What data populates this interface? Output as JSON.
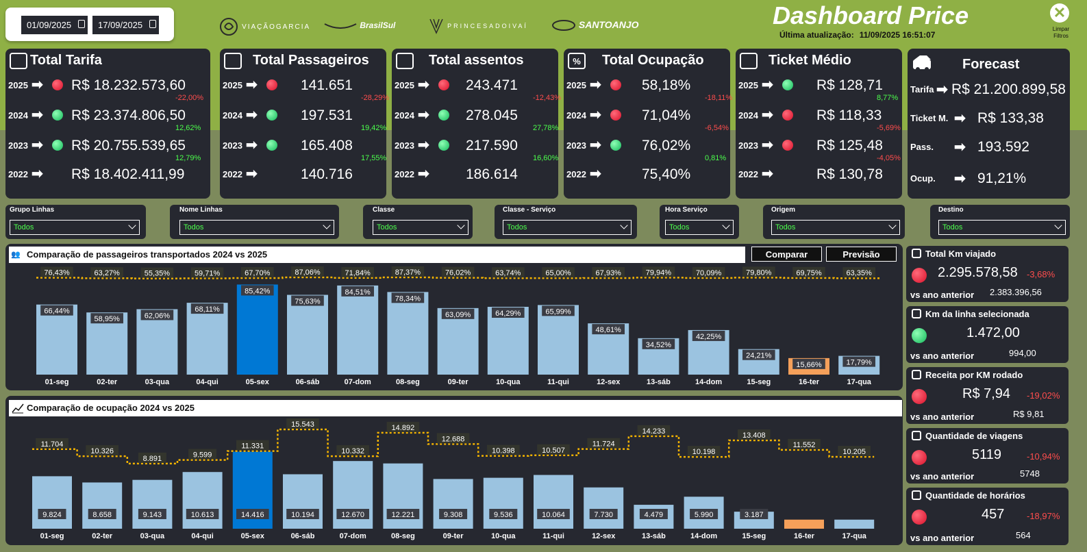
{
  "header": {
    "date_from": "01/09/2025",
    "date_to": "17/09/2025",
    "logos": [
      "VIAÇÃOGARCIA",
      "BrasilSul",
      "PRINCESADOIVAÍ",
      "SANTOANJO"
    ],
    "title": "Dashboard Price",
    "update_label": "Última atualização:",
    "update_value": "11/09/2025 16:51:07",
    "clear_label": "Limpar Filtros"
  },
  "cards": [
    {
      "title": "Total Tarifa",
      "icon": "cash-icon",
      "rows": [
        {
          "year": "2025",
          "dot": "red",
          "value": "R$ 18.232.573,60",
          "pct": "-22,00%",
          "pct_type": "neg"
        },
        {
          "year": "2024",
          "dot": "green",
          "value": "R$ 23.374.806,50",
          "pct": "12,62%",
          "pct_type": "pos"
        },
        {
          "year": "2023",
          "dot": "green",
          "value": "R$ 20.755.539,65",
          "pct": "12,79%",
          "pct_type": "pos"
        },
        {
          "year": "2022",
          "dot": "",
          "value": "R$ 18.402.411,99",
          "pct": "",
          "pct_type": ""
        }
      ]
    },
    {
      "title": "Total Passageiros",
      "icon": "people-icon",
      "rows": [
        {
          "year": "2025",
          "dot": "red",
          "value": "141.651",
          "pct": "-28,29%",
          "pct_type": "neg"
        },
        {
          "year": "2024",
          "dot": "green",
          "value": "197.531",
          "pct": "19,42%",
          "pct_type": "pos"
        },
        {
          "year": "2023",
          "dot": "green",
          "value": "165.408",
          "pct": "17,55%",
          "pct_type": "pos"
        },
        {
          "year": "2022",
          "dot": "",
          "value": "140.716",
          "pct": "",
          "pct_type": ""
        }
      ]
    },
    {
      "title": "Total assentos",
      "icon": "seat-icon",
      "rows": [
        {
          "year": "2025",
          "dot": "red",
          "value": "243.471",
          "pct": "-12,43%",
          "pct_type": "neg"
        },
        {
          "year": "2024",
          "dot": "green",
          "value": "278.045",
          "pct": "27,78%",
          "pct_type": "pos"
        },
        {
          "year": "2023",
          "dot": "green",
          "value": "217.590",
          "pct": "16,60%",
          "pct_type": "pos"
        },
        {
          "year": "2022",
          "dot": "",
          "value": "186.614",
          "pct": "",
          "pct_type": ""
        }
      ]
    },
    {
      "title": "Total Ocupação",
      "icon": "percent-icon",
      "rows": [
        {
          "year": "2025",
          "dot": "red",
          "value": "58,18%",
          "pct": "-18,11%",
          "pct_type": "neg"
        },
        {
          "year": "2024",
          "dot": "red",
          "value": "71,04%",
          "pct": "-6,54%",
          "pct_type": "neg"
        },
        {
          "year": "2023",
          "dot": "green",
          "value": "76,02%",
          "pct": "0,81%",
          "pct_type": "pos"
        },
        {
          "year": "2022",
          "dot": "",
          "value": "75,40%",
          "pct": "",
          "pct_type": ""
        }
      ]
    },
    {
      "title": "Ticket Médio",
      "icon": "ticket-icon",
      "rows": [
        {
          "year": "2025",
          "dot": "green",
          "value": "R$ 128,71",
          "pct": "8,77%",
          "pct_type": "pos"
        },
        {
          "year": "2024",
          "dot": "red",
          "value": "R$ 118,33",
          "pct": "-5,69%",
          "pct_type": "neg"
        },
        {
          "year": "2023",
          "dot": "red",
          "value": "R$ 125,48",
          "pct": "-4,05%",
          "pct_type": "neg"
        },
        {
          "year": "2022",
          "dot": "",
          "value": "R$ 130,78",
          "pct": "",
          "pct_type": ""
        }
      ]
    }
  ],
  "forecast": {
    "title": "Forecast",
    "rows": [
      {
        "label": "Tarifa",
        "value": "R$ 21.200.899,58"
      },
      {
        "label": "Ticket M.",
        "value": "R$ 133,38"
      },
      {
        "label": "Pass.",
        "value": "193.592"
      },
      {
        "label": "Ocup.",
        "value": "91,21%"
      }
    ]
  },
  "filters": [
    {
      "label": "Grupo Linhas",
      "value": "Todos"
    },
    {
      "label": "Nome Linhas",
      "value": "Todos"
    },
    {
      "label": "Classe",
      "value": "Todos"
    },
    {
      "label": "Classe - Serviço",
      "value": "Todos"
    },
    {
      "label": "Hora Serviço",
      "value": "Todos"
    },
    {
      "label": "Origem",
      "value": "Todos"
    },
    {
      "label": "Destino",
      "value": "Todos"
    }
  ],
  "buttons": {
    "compare": "Comparar",
    "forecast": "Previsão"
  },
  "chart_data": [
    {
      "type": "bar",
      "title": "Comparação de passageiros transportados 2024 vs 2025",
      "categories": [
        "01-seg",
        "02-ter",
        "03-qua",
        "04-qui",
        "05-sex",
        "06-sáb",
        "07-dom",
        "08-seg",
        "09-ter",
        "10-qua",
        "11-qui",
        "12-sex",
        "13-sáb",
        "14-dom",
        "15-seg",
        "16-ter",
        "17-qua"
      ],
      "series": [
        {
          "values": [
            66.44,
            58.95,
            62.06,
            68.11,
            85.42,
            75.63,
            84.51,
            78.34,
            63.09,
            64.29,
            65.99,
            48.61,
            34.52,
            42.25,
            24.21,
            15.66,
            17.79
          ],
          "labels": [
            "66,44%",
            "58,95%",
            "62,06%",
            "68,11%",
            "85,42%",
            "75,63%",
            "84,51%",
            "78,34%",
            "63,09%",
            "64,29%",
            "65,99%",
            "48,61%",
            "34,52%",
            "42,25%",
            "24,21%",
            "15,66%",
            "17,79%"
          ]
        },
        {
          "type": "line",
          "values": [
            76.43,
            63.27,
            55.35,
            59.71,
            67.7,
            87.06,
            71.84,
            87.37,
            76.02,
            63.74,
            65.0,
            67.93,
            79.94,
            70.09,
            79.8,
            69.75,
            63.35
          ],
          "labels": [
            "76,43%",
            "63,27%",
            "55,35%",
            "59,71%",
            "67,70%",
            "87,06%",
            "71,84%",
            "87,37%",
            "76,02%",
            "63,74%",
            "65,00%",
            "67,93%",
            "79,94%",
            "70,09%",
            "79,80%",
            "69,75%",
            "63,35%"
          ]
        }
      ],
      "highlight": {
        "05-sex": "#0078d4",
        "16-ter": "#f5a05a"
      },
      "colors": {
        "bar": "#9bc3e0",
        "line": "#f5b400"
      }
    },
    {
      "type": "bar",
      "title": "Comparação de ocupação 2024 vs 2025",
      "categories": [
        "01-seg",
        "02-ter",
        "03-qua",
        "04-qui",
        "05-sex",
        "06-sáb",
        "07-dom",
        "08-seg",
        "09-ter",
        "10-qua",
        "11-qui",
        "12-sex",
        "13-sáb",
        "14-dom",
        "15-seg",
        "16-ter",
        "17-qua"
      ],
      "series": [
        {
          "values": [
            9824,
            8658,
            9143,
            10613,
            14416,
            10194,
            12670,
            12221,
            9308,
            9536,
            10064,
            7730,
            4479,
            5990,
            3187,
            1700,
            1700
          ],
          "labels": [
            "9.824",
            "8.658",
            "9.143",
            "10.613",
            "14.416",
            "10.194",
            "12.670",
            "12.221",
            "9.308",
            "9.536",
            "10.064",
            "7.730",
            "4.479",
            "5.990",
            "3.187",
            "",
            ""
          ]
        },
        {
          "type": "line",
          "values": [
            11704,
            10326,
            8891,
            9599,
            11331,
            15543,
            10332,
            14892,
            12688,
            10398,
            10507,
            11724,
            14233,
            10198,
            13408,
            11552,
            10205
          ],
          "labels": [
            "11.704",
            "10.326",
            "8.891",
            "9.599",
            "11.331",
            "15.543",
            "10.332",
            "14.892",
            "12.688",
            "10.398",
            "10.507",
            "11.724",
            "14.233",
            "10.198",
            "13.408",
            "11.552",
            "10.205"
          ]
        }
      ],
      "highlight": {
        "05-sex": "#0078d4",
        "16-ter": "#f5a05a"
      },
      "colors": {
        "bar": "#9bc3e0",
        "line": "#f5b400"
      }
    }
  ],
  "side": [
    {
      "title": "Total Km viajado",
      "value": "2.295.578,58",
      "pct": "-3,68%",
      "prev_label": "vs ano anterior",
      "prev_value": "2.383.396,56"
    },
    {
      "title": "Km da linha selecionada",
      "value": "1.472,00",
      "pct": "",
      "prev_label": "vs ano anterior",
      "prev_value": "994,00"
    },
    {
      "title": "Receita por KM rodado",
      "value": "R$ 7,94",
      "pct": "-19,02%",
      "prev_label": "vs ano anterior",
      "prev_value": "R$ 9,81"
    },
    {
      "title": "Quantidade de viagens",
      "value": "5119",
      "pct": "-10,94%",
      "prev_label": "vs ano anterior",
      "prev_value": "5748"
    },
    {
      "title": "Quantidade de horários",
      "value": "457",
      "pct": "-18,97%",
      "prev_label": "vs ano anterior",
      "prev_value": "564"
    }
  ]
}
